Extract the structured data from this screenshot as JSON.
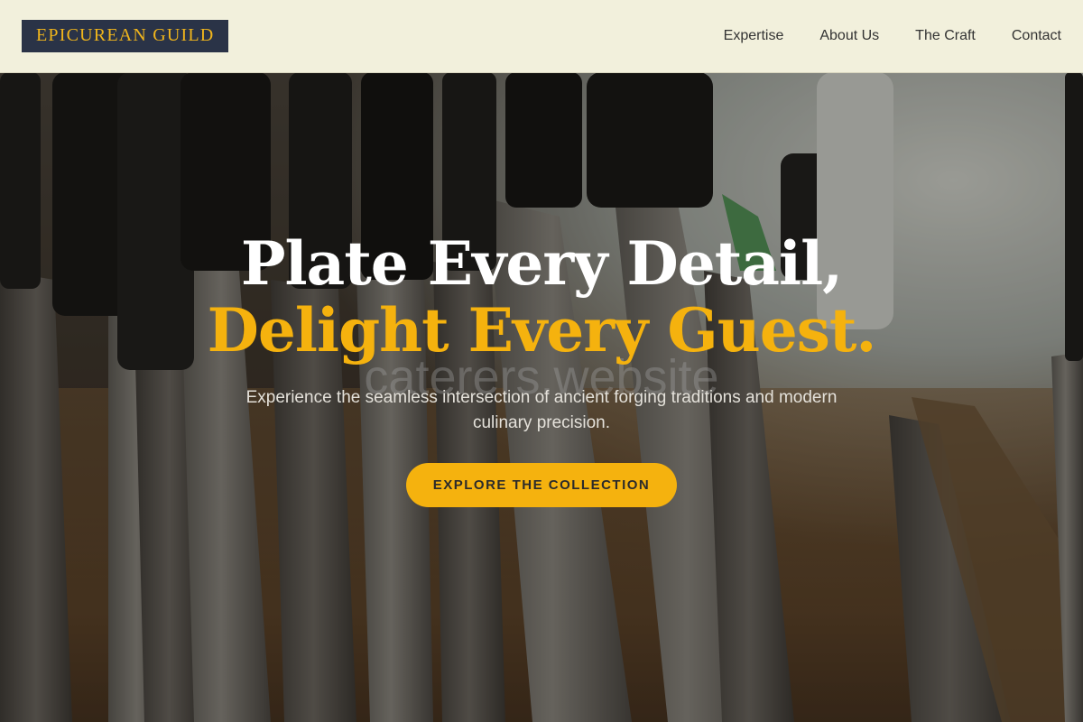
{
  "header": {
    "logo_text": "EPICUREAN GUILD",
    "nav": [
      {
        "label": "Expertise"
      },
      {
        "label": "About Us"
      },
      {
        "label": "The Craft"
      },
      {
        "label": "Contact"
      }
    ]
  },
  "hero": {
    "headline_line1": "Plate Every Detail,",
    "headline_line2": "Delight Every Guest.",
    "watermark": "caterers.website",
    "subtitle": "Experience the seamless intersection of ancient forging traditions and modern culinary precision.",
    "cta_label": "EXPLORE THE COLLECTION"
  },
  "colors": {
    "accent": "#f5b20e",
    "header_bg": "#f2f0dc",
    "logo_bg": "#2a3347"
  }
}
